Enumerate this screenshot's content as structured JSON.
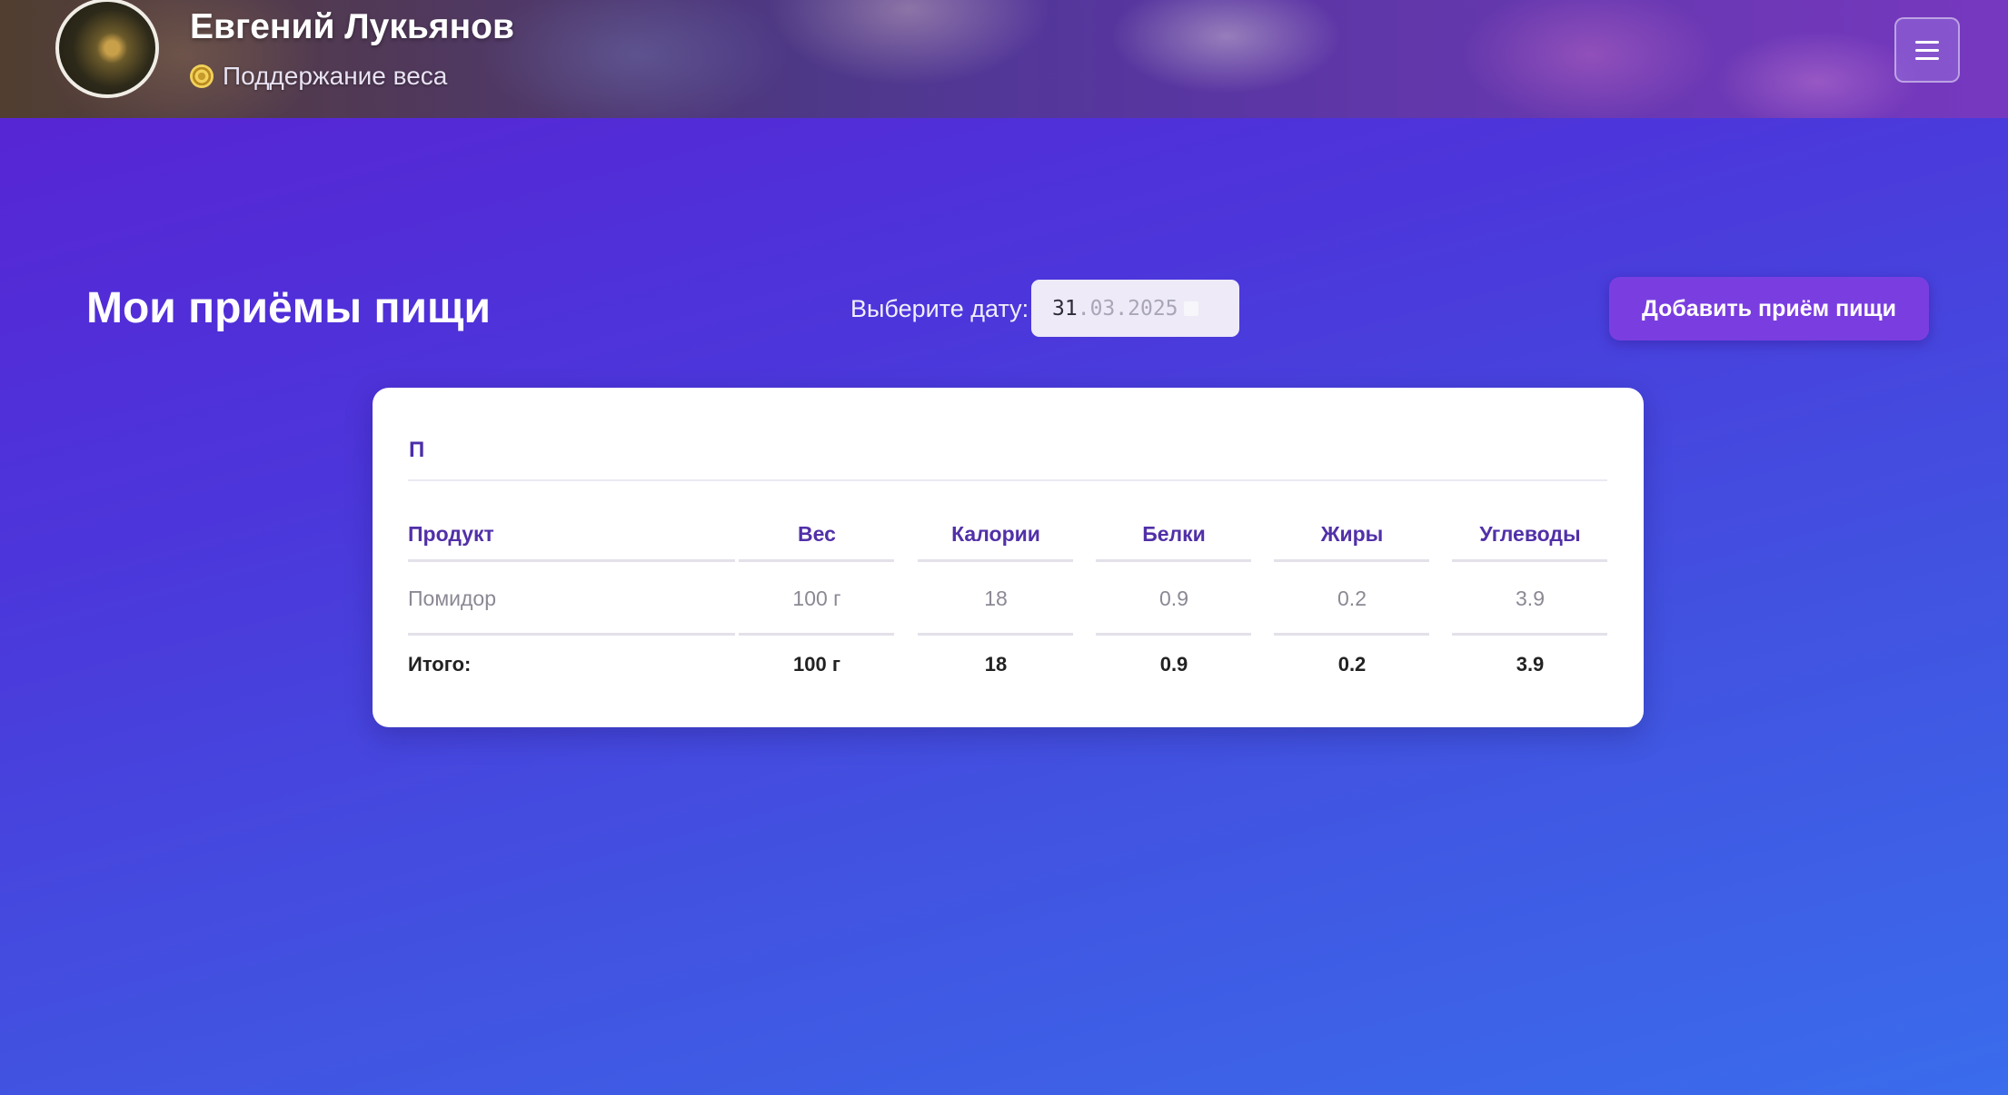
{
  "header": {
    "user_name": "Евгений Лукьянов",
    "goal": "Поддержание веса",
    "menu_icon": "hamburger-icon"
  },
  "toolbar": {
    "title": "Мои приёмы пищи",
    "date_label": "Выберите дату:",
    "date_value": {
      "day": "31",
      "month": "03",
      "year": "2025"
    },
    "add_button": "Добавить приём пищи"
  },
  "meal": {
    "name": "П",
    "columns": [
      "Продукт",
      "Вес",
      "Калории",
      "Белки",
      "Жиры",
      "Углеводы"
    ],
    "rows": [
      [
        "Помидор",
        "100 г",
        "18",
        "0.9",
        "0.2",
        "3.9"
      ]
    ],
    "totals": [
      "Итого:",
      "100 г",
      "18",
      "0.9",
      "0.2",
      "3.9"
    ]
  },
  "colors": {
    "accent": "#7a3ee0",
    "heading": "#5130a8",
    "background_start": "#5a21d2",
    "background_end": "#3a6cec"
  }
}
